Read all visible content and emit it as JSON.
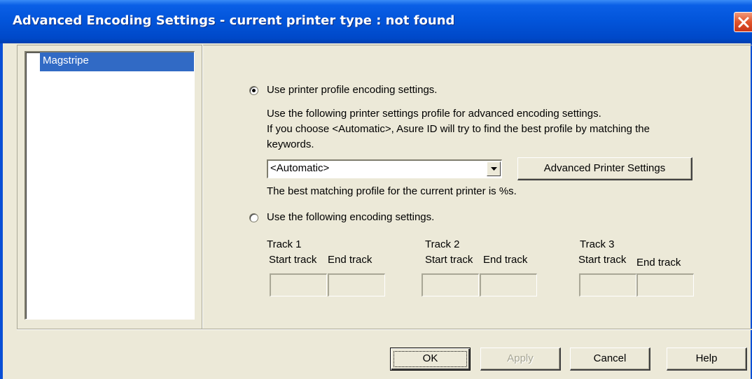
{
  "window": {
    "title": "Advanced Encoding Settings - current printer type : not found"
  },
  "tree": {
    "items": [
      {
        "label": "Magstripe",
        "selected": true
      }
    ]
  },
  "profile_option": {
    "label": "Use printer profile encoding settings.",
    "selected": true,
    "description_line1": "Use the following printer settings profile for advanced encoding settings.",
    "description_line2": "If you choose <Automatic>, Asure ID will try to find the best profile by matching the",
    "description_line3": "keywords.",
    "profile_select_value": "<Automatic>",
    "advanced_button_label": "Advanced Printer Settings",
    "best_match_text": "The best matching profile for the current printer is %s."
  },
  "custom_option": {
    "label": "Use the following encoding settings.",
    "selected": false,
    "tracks": [
      {
        "title": "Track 1",
        "start_label": "Start track",
        "end_label": "End track",
        "start_value": "",
        "end_value": ""
      },
      {
        "title": "Track 2",
        "start_label": "Start track",
        "end_label": "End track",
        "start_value": "",
        "end_value": ""
      },
      {
        "title": "Track 3",
        "start_label": "Start track",
        "end_label": "End track",
        "start_value": "",
        "end_value": ""
      }
    ]
  },
  "buttons": {
    "ok": "OK",
    "apply": "Apply",
    "cancel": "Cancel",
    "help": "Help"
  },
  "icons": {
    "close": "close-icon",
    "dropdown": "chevron-down-icon"
  },
  "colors": {
    "titlebar": "#0254d9",
    "selection": "#316ac5",
    "close_button": "#e0532a",
    "dialog_bg": "#ece9d8"
  }
}
